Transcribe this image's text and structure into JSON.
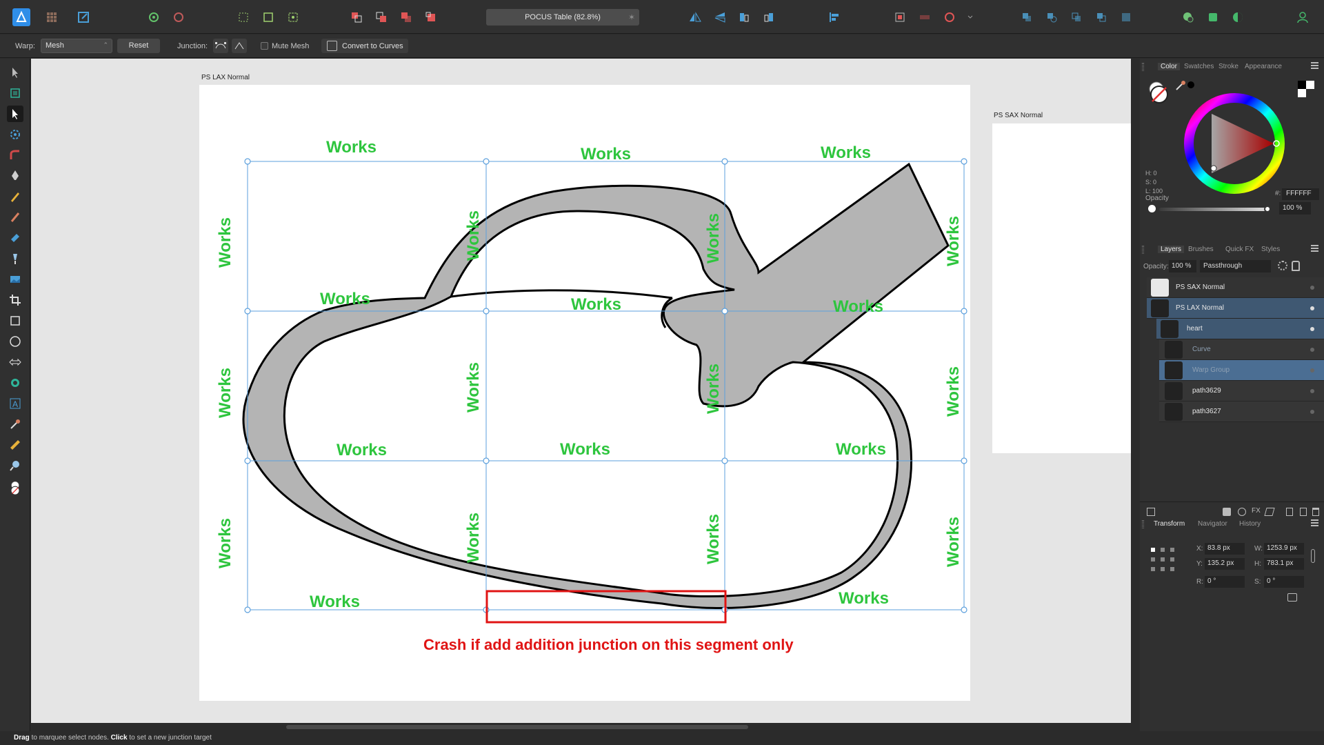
{
  "document": {
    "title": "POCUS Table (82.8%)"
  },
  "context_toolbar": {
    "warp_label": "Warp:",
    "warp_value": "Mesh",
    "reset_label": "Reset",
    "junction_label": "Junction:",
    "mute_mesh_label": "Mute Mesh",
    "convert_label": "Convert to Curves"
  },
  "artboards": {
    "lax_label": "PS LAX Normal",
    "sax_label": "PS SAX Normal"
  },
  "annotations": {
    "works": "Works",
    "crash_note": "Crash if add addition junction on this segment only"
  },
  "colors": {
    "works": "#2ec53e",
    "crash": "#e01414",
    "mesh": "#5b9fdc",
    "heart_fill": "#b4b4b4",
    "accent": "#3f5872"
  },
  "color_panel": {
    "tabs": [
      "Color",
      "Swatches",
      "Stroke",
      "Appearance"
    ],
    "h": "H: 0",
    "s": "S: 0",
    "l": "L: 100",
    "opacity_label": "Opacity",
    "hex_label": "#:",
    "hex": "FFFFFF",
    "opacity_value": "100 %"
  },
  "layers_panel": {
    "tabs": [
      "Layers",
      "Brushes",
      "Quick FX",
      "Styles"
    ],
    "opacity_label": "Opacity:",
    "opacity_value": "100 %",
    "blend_mode": "Passthrough",
    "items": [
      {
        "name": "PS SAX Normal"
      },
      {
        "name": "PS LAX Normal"
      },
      {
        "name": "heart"
      },
      {
        "name": "Curve"
      },
      {
        "name": "Warp Group"
      },
      {
        "name": "path3629"
      },
      {
        "name": "path3627"
      }
    ]
  },
  "transform_panel": {
    "tabs": [
      "Transform",
      "Navigator",
      "History"
    ],
    "x_label": "X:",
    "x": "83.8 px",
    "y_label": "Y:",
    "y": "135.2 px",
    "w_label": "W:",
    "w": "1253.9 px",
    "h_label": "H:",
    "h": "783.1 px",
    "r_label": "R:",
    "r": "0 °",
    "s_label": "S:",
    "s": "0 °"
  },
  "status": {
    "drag_bold": "Drag",
    "drag_text": " to marquee select nodes. ",
    "click_bold": "Click",
    "click_text": " to set a new junction target"
  }
}
